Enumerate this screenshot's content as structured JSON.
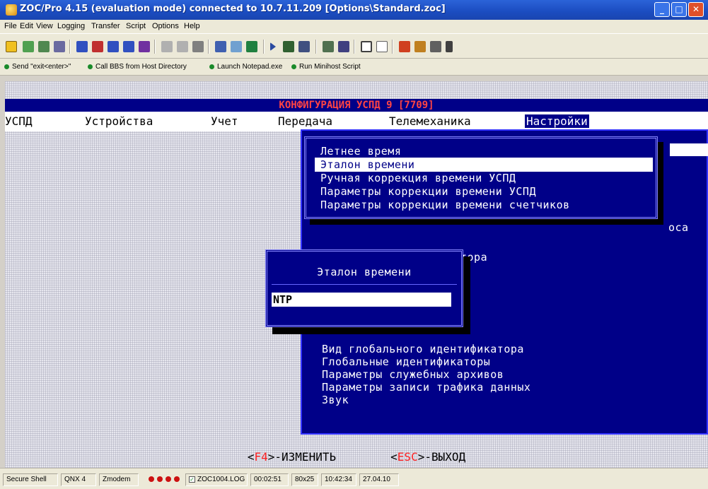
{
  "window": {
    "title": "ZOC/Pro 4.15  (evaluation mode) connected to 10.7.11.209 [Options\\Standard.zoc]",
    "min_glyph": "_",
    "max_glyph": "□",
    "close_glyph": "✕"
  },
  "menubar": {
    "items": [
      "File",
      "Edit",
      "View",
      "Logging",
      "Transfer",
      "Script",
      "Options",
      "Help"
    ]
  },
  "quickbar": {
    "items": [
      "Send \"exit<enter>\"",
      "Call BBS from Host Directory",
      "Launch Notepad.exe",
      "Run Minihost Script"
    ]
  },
  "terminal": {
    "header": "КОНФИГУРАЦИЯ УСПД 9   [7709]",
    "menu": [
      "УСПД",
      "Устройства",
      "Учет",
      "Передача",
      "Телемеханика",
      "Настройки"
    ],
    "active_menu": "Настройки",
    "submenu": [
      "Летнее время",
      "Эталон времени",
      "Ручная коррекция времени УСПД",
      "Параметры коррекции времени УСПД",
      "Параметры коррекции времени счетчиков"
    ],
    "selected_submenu": "Эталон времени",
    "panel_fragments": [
      "оса",
      "тора"
    ],
    "panel_items": [
      "Вид глобального идентификатора",
      "Глобальные идентификаторы",
      "Параметры служебных архивов",
      "Параметры записи трафика данных",
      "Звук"
    ],
    "dialog": {
      "title": "Эталон времени",
      "value": "NTP"
    },
    "fkeys": {
      "edit_key": "F4",
      "edit_label": ">-ИЗМЕНИТЬ",
      "exit_key": "ESC",
      "exit_label": ">-ВЫХОД"
    }
  },
  "statusbar": {
    "session": "Secure Shell",
    "emulation": "QNX 4",
    "transfer": "Zmodem",
    "logfile": "ZOC1004.LOG",
    "online_time": "00:02:51",
    "size": "80x25",
    "clock": "10:42:34",
    "date": "27.04.10"
  }
}
